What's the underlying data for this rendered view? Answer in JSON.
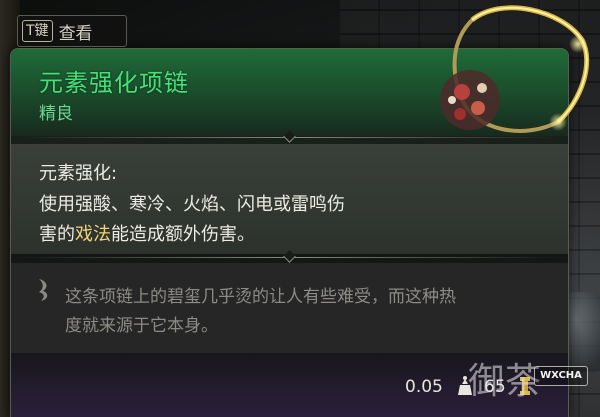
{
  "hint": {
    "key": "T键",
    "label": "查看"
  },
  "item": {
    "name": "元素强化项链",
    "rarity": "精良",
    "effect": {
      "name": "元素强化:",
      "line1": "使用强酸、寒冷、火焰、闪电或雷鸣伤",
      "line2_pre": "害的",
      "line2_highlight": "戏法",
      "line2_post": "能造成额外伤害。"
    },
    "flavor": {
      "line1": "这条项链上的碧玺几乎烫的让人有些难受，而这种热",
      "line2": "度就来源于它本身。"
    },
    "weight": "0.05",
    "price": "65"
  },
  "watermark": {
    "text": "御茶",
    "badge": "WXCHA"
  },
  "colors": {
    "title": "#43e07a",
    "rarity": "#6bd892",
    "header_green": "#1f6b38",
    "highlight": "#f0d37a",
    "flavor_text": "#8d8b85"
  },
  "icons": {
    "flavor": "quill-icon",
    "weight": "weight-icon",
    "price": "gold-coin-icon",
    "item": "necklace-icon"
  }
}
